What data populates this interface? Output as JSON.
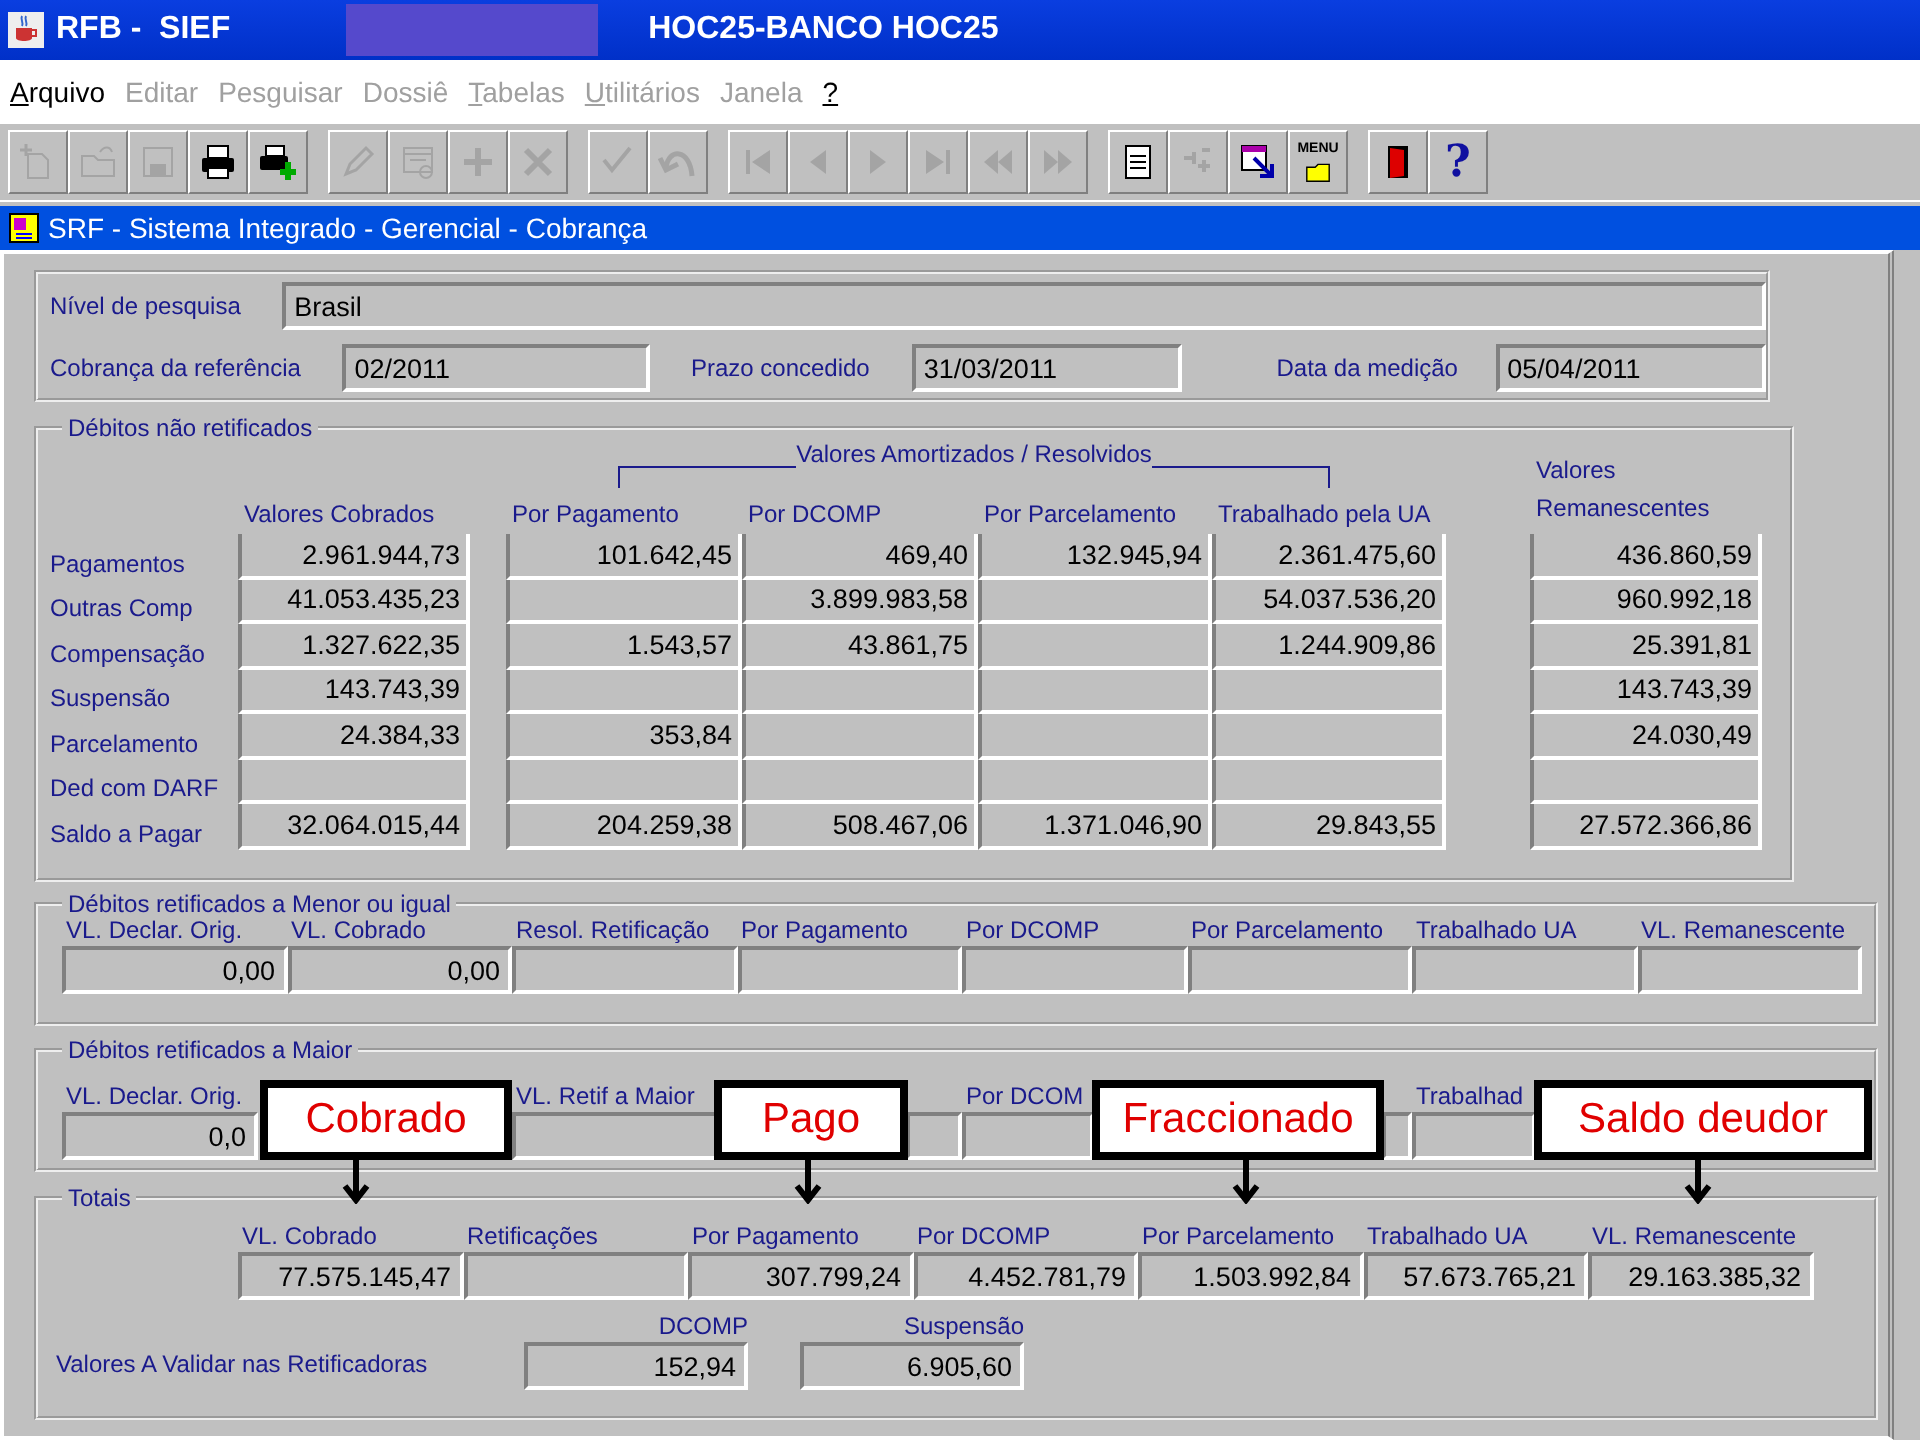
{
  "window": {
    "title": "RFB -  SIEF",
    "database": "HOC25-BANCO HOC25"
  },
  "menu": [
    {
      "label": "Arquivo",
      "disabled": false,
      "mnemonic": true
    },
    {
      "label": "Editar",
      "disabled": true,
      "mnemonic": false
    },
    {
      "label": "Pesguisar",
      "disabled": true,
      "mnemonic": false
    },
    {
      "label": "Dossiê",
      "disabled": true,
      "mnemonic": false
    },
    {
      "label": "Tabelas",
      "disabled": true,
      "mnemonic": true
    },
    {
      "label": "Utilitários",
      "disabled": true,
      "mnemonic": true
    },
    {
      "label": "Janela",
      "disabled": true,
      "mnemonic": false
    },
    {
      "label": "?",
      "disabled": false,
      "mnemonic": true
    }
  ],
  "toolbar": [
    [
      {
        "kind": "new",
        "disabled": true
      },
      {
        "kind": "open",
        "disabled": true
      },
      {
        "kind": "save",
        "disabled": true
      },
      {
        "kind": "print",
        "disabled": false
      },
      {
        "kind": "print-add",
        "disabled": false
      }
    ],
    [
      {
        "kind": "edit",
        "disabled": true
      },
      {
        "kind": "query",
        "disabled": true
      },
      {
        "kind": "insert",
        "disabled": true
      },
      {
        "kind": "delete",
        "disabled": true
      }
    ],
    [
      {
        "kind": "check",
        "disabled": true
      },
      {
        "kind": "undo",
        "disabled": true
      }
    ],
    [
      {
        "kind": "first",
        "disabled": true
      },
      {
        "kind": "prev",
        "disabled": true
      },
      {
        "kind": "next",
        "disabled": true
      },
      {
        "kind": "last",
        "disabled": true
      },
      {
        "kind": "rewind",
        "disabled": true
      },
      {
        "kind": "forward",
        "disabled": true
      }
    ],
    [
      {
        "kind": "doc",
        "disabled": false
      },
      {
        "kind": "calc",
        "disabled": true
      },
      {
        "kind": "window",
        "disabled": false
      },
      {
        "kind": "menu",
        "disabled": false,
        "label": "MENU"
      }
    ],
    [
      {
        "kind": "exit",
        "disabled": false
      },
      {
        "kind": "help",
        "disabled": false,
        "label": "?"
      }
    ]
  ],
  "form": {
    "title": "SRF - Sistema Integrado - Gerencial - Cobrança",
    "nivel": {
      "label": "Nível de pesquisa",
      "value": "Brasil"
    },
    "dates": [
      {
        "label": "Cobrança da referência",
        "value": "02/2011"
      },
      {
        "label": "Prazo concedido",
        "value": "31/03/2011"
      },
      {
        "label": "Data da medição",
        "value": "05/04/2011"
      }
    ]
  },
  "nao_retificados": {
    "title": "Débitos não retificados",
    "group_title": "Valores Amortizados / Resolvidos",
    "columns": [
      "Valores Cobrados",
      "Por Pagamento",
      "Por DCOMP",
      "Por Parcelamento",
      "Trabalhado pela UA",
      "Valores Remanescentes"
    ],
    "rows": [
      {
        "label": "Pagamentos",
        "cells": {
          "cobrados": "2.961.944,73",
          "pagamento": "101.642,45",
          "dcomp": "469,40",
          "parcelamento": "132.945,94",
          "trabalhado": "2.361.475,60",
          "remanescentes": "436.860,59"
        }
      },
      {
        "label": "Outras Comp",
        "cells": {
          "cobrados": "41.053.435,23",
          "dcomp": "3.899.983,58",
          "trabalhado": "54.037.536,20",
          "remanescentes": "960.992,18"
        }
      },
      {
        "label": "Compensação",
        "cells": {
          "cobrados": "1.327.622,35",
          "pagamento": "1.543,57",
          "dcomp": "43.861,75",
          "trabalhado": "1.244.909,86",
          "remanescentes": "25.391,81"
        }
      },
      {
        "label": "Suspensão",
        "cells": {
          "cobrados": "143.743,39",
          "remanescentes": "143.743,39"
        }
      },
      {
        "label": "Parcelamento",
        "cells": {
          "cobrados": "24.384,33",
          "pagamento": "353,84",
          "remanescentes": "24.030,49"
        }
      },
      {
        "label": "Ded com DARF",
        "cells": {}
      },
      {
        "label": "Saldo a Pagar",
        "cells": {
          "cobrados": "32.064.015,44",
          "pagamento": "204.259,38",
          "dcomp": "508.467,06",
          "parcelamento": "1.371.046,90",
          "trabalhado": "29.843,55",
          "remanescentes": "27.572.366,86"
        }
      }
    ]
  },
  "menor": {
    "title": "Débitos retificados a Menor ou igual",
    "columns": [
      {
        "label": "VL. Declar. Orig.",
        "value": "0,00"
      },
      {
        "label": "VL. Cobrado",
        "value": "0,00"
      },
      {
        "label": "Resol. Retificação"
      },
      {
        "label": "Por Pagamento"
      },
      {
        "label": "Por DCOMP"
      },
      {
        "label": "Por Parcelamento"
      },
      {
        "label": "Trabalhado UA"
      },
      {
        "label": "VL. Remanescente"
      }
    ]
  },
  "maior": {
    "title": "Débitos retificados a Maior",
    "columns": [
      {
        "kind": "field",
        "label": "VL. Declar. Orig.",
        "value": "0,0"
      },
      {
        "kind": "field",
        "label": "VL. Retif a Maior"
      },
      {
        "kind": "field"
      },
      {
        "kind": "field",
        "label": "Por DCOM"
      },
      {
        "kind": "field"
      },
      {
        "kind": "field",
        "label": "Trabalhad"
      }
    ]
  },
  "totais": {
    "title": "Totais",
    "columns": [
      {
        "label": "VL. Cobrado",
        "value": "77.575.145,47"
      },
      {
        "label": "Retificações"
      },
      {
        "label": "Por Pagamento",
        "value": "307.799,24"
      },
      {
        "label": "Por DCOMP",
        "value": "4.452.781,79"
      },
      {
        "label": "Por Parcelamento",
        "value": "1.503.992,84"
      },
      {
        "label": "Trabalhado UA",
        "value": "57.673.765,21"
      },
      {
        "label": "VL. Remanescente",
        "value": "29.163.385,32"
      }
    ],
    "validar": {
      "label": "Valores A Validar nas Retificadoras",
      "items": [
        {
          "label": "DCOMP",
          "value": "152,94"
        },
        {
          "label": "Suspensão",
          "value": "6.905,60"
        }
      ]
    }
  },
  "callouts": [
    {
      "text": "Cobrado"
    },
    {
      "text": "Pago"
    },
    {
      "text": "Fraccionado"
    },
    {
      "text": "Saldo deudor"
    }
  ]
}
